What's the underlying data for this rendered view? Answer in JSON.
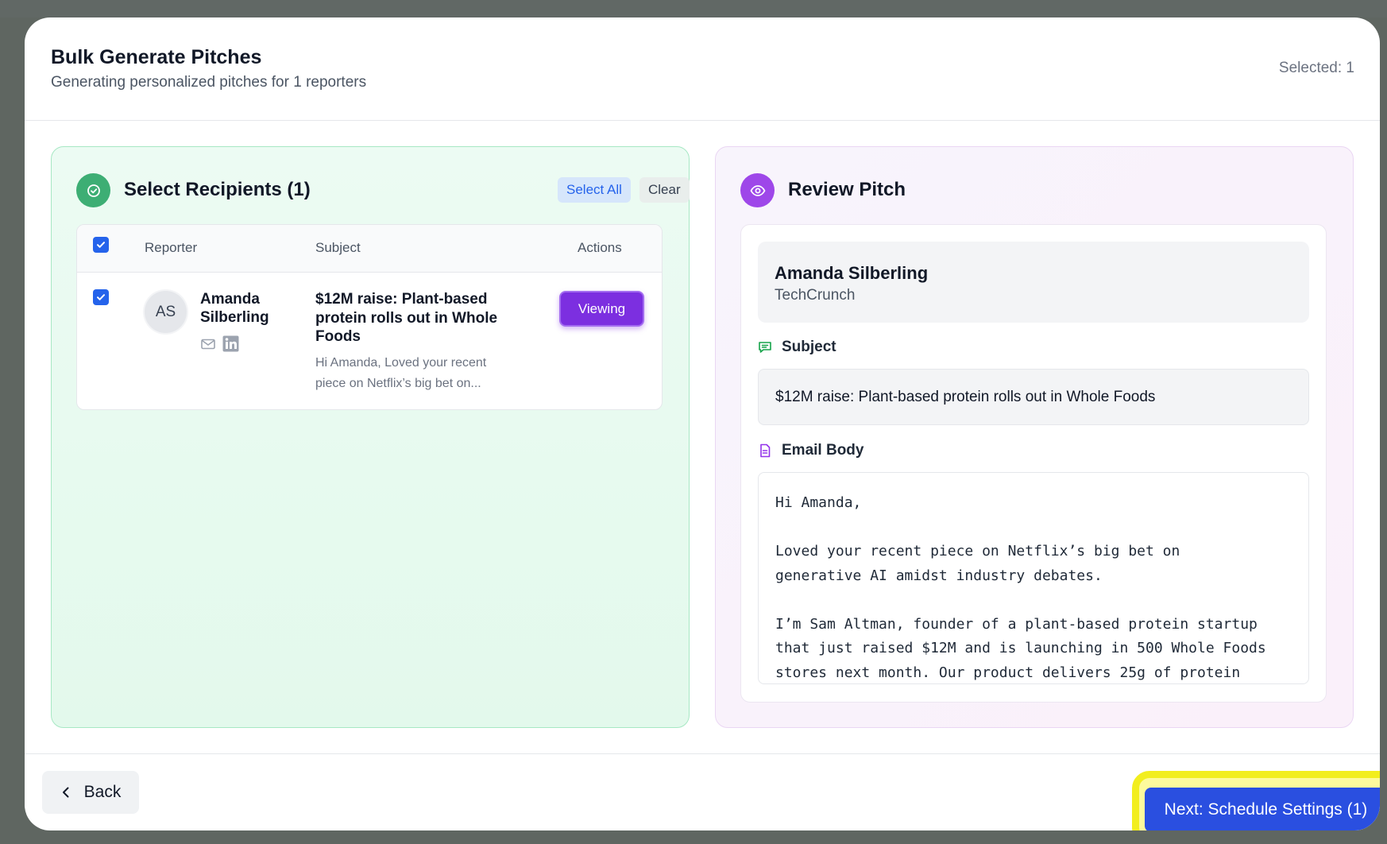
{
  "modal": {
    "title": "Bulk Generate Pitches",
    "subtitle": "Generating personalized pitches for 1 reporters",
    "selected_count": "Selected: 1"
  },
  "recipients_panel": {
    "heading": "Select Recipients (1)",
    "select_all_label": "Select All",
    "clear_label": "Clear",
    "columns": [
      "Reporter",
      "Subject",
      "Actions"
    ],
    "header_checked": true,
    "rows": [
      {
        "checked": true,
        "initials": "AS",
        "reporter_name": "Amanda Silberling",
        "subject": "$12M raise: Plant-based protein rolls out in Whole Foods",
        "snippet": "Hi Amanda, Loved your recent piece on Netflix’s big bet on...",
        "action_label": "Viewing",
        "contact_icons": [
          "mail-icon",
          "linkedin-icon"
        ]
      }
    ]
  },
  "review_panel": {
    "heading": "Review Pitch",
    "recipient_name": "Amanda Silberling",
    "recipient_outlet": "TechCrunch",
    "subject_label": "Subject",
    "subject_value": "$12M raise: Plant-based protein rolls out in Whole Foods",
    "body_label": "Email Body",
    "body_text": "Hi Amanda,\n\nLoved your recent piece on Netflix’s big bet on\ngenerative AI amidst industry debates.\n\nI’m Sam Altman, founder of a plant-based protein startup\nthat just raised $12M and is launching in 500 Whole Foods\nstores next month. Our product delivers 25g of protein"
  },
  "footer": {
    "back_label": "Back",
    "next_label": "Next: Schedule Settings (1)"
  },
  "colors": {
    "primary_blue": "#2a4fe0",
    "viewing_purple": "#7c2fe0",
    "success_green": "#3dae74",
    "review_purple": "#9e47e9",
    "highlight_yellow": "#f2ee1e"
  }
}
